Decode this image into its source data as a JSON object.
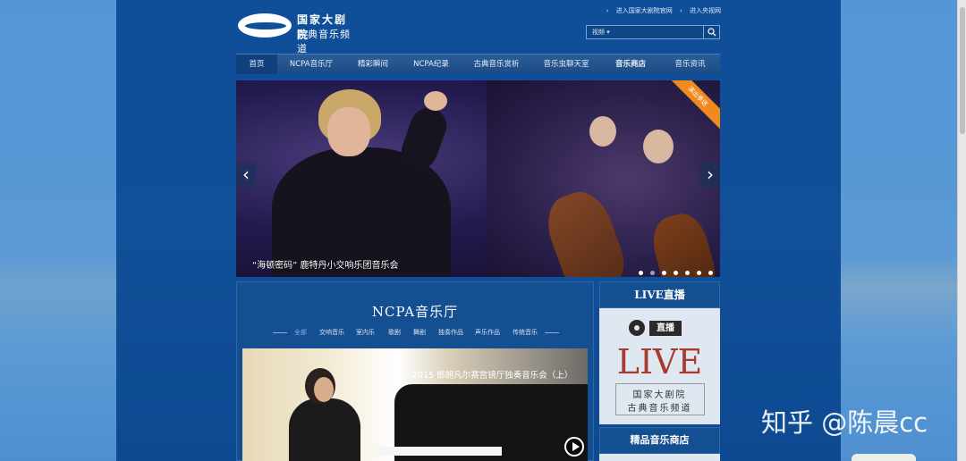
{
  "header": {
    "logo_line1": "国家大剧院",
    "logo_line2": "古典音乐频道",
    "top_links": [
      "进入国家大剧院官网",
      "进入央视网"
    ],
    "search_select": "视频",
    "search_placeholder": ""
  },
  "nav": {
    "items": [
      {
        "label": "首页"
      },
      {
        "label": "NCPA音乐厅"
      },
      {
        "label": "精彩瞬间"
      },
      {
        "label": "NCPA纪录"
      },
      {
        "label": "古典音乐赏析"
      },
      {
        "label": "音乐虫聊天室"
      },
      {
        "label": "音乐商店"
      },
      {
        "label": "音乐资讯"
      }
    ],
    "active_index": 0
  },
  "banner": {
    "caption": "“海顿密码” 鹿特丹小交响乐团音乐会",
    "ribbon": "演出季送",
    "prev_glyph": "‹",
    "next_glyph": "›",
    "dot_count": 7,
    "active_dot": 1
  },
  "concert": {
    "title": "NCPA音乐厅",
    "categories": [
      "全部",
      "交响音乐",
      "室内乐",
      "歌剧",
      "舞剧",
      "独奏作品",
      "声乐作品",
      "传统音乐"
    ],
    "featured_title": "2015 郎朗凡尔赛宫镜厅独奏音乐会（上）"
  },
  "live": {
    "head": "LIVE直播",
    "badge": "直播",
    "big": "LIVE",
    "sub1": "国家大剧院",
    "sub2": "古典音乐频道",
    "shop_head": "精品音乐商店"
  },
  "watermark": "知乎 @陈晨cc",
  "colors": {
    "page_bg": "#4f8fd0",
    "site_bg": "#114f98",
    "nav_bg": "#1c4c86",
    "ribbon": "#f08a1c",
    "live_red": "#a93a2f"
  }
}
